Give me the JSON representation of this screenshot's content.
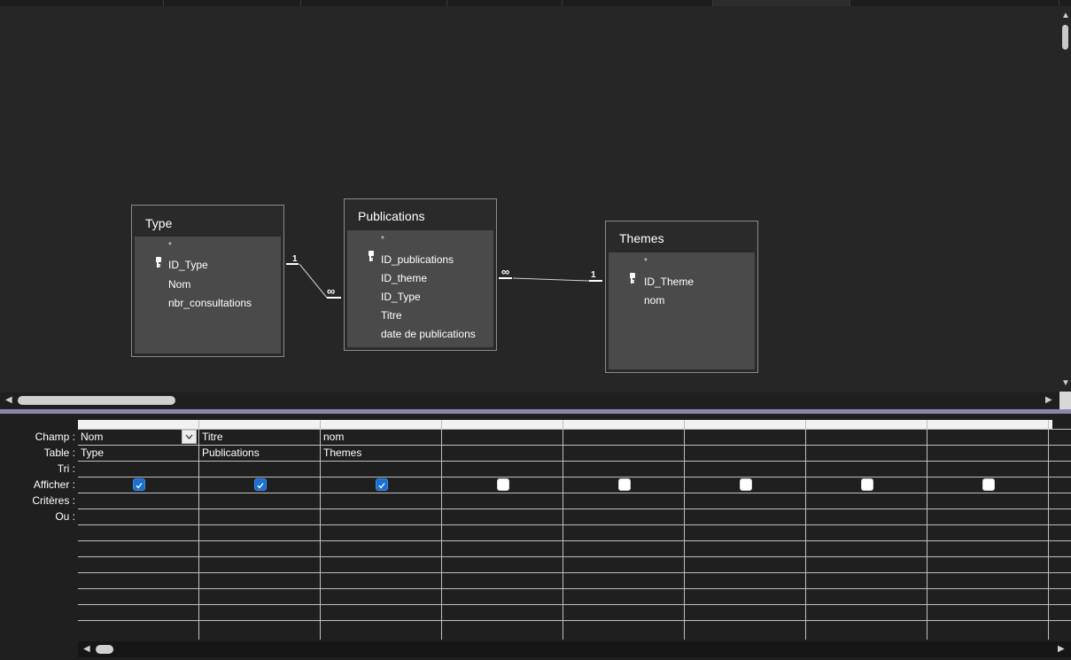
{
  "tables": {
    "type": {
      "title": "Type",
      "star": "*",
      "fields": [
        "ID_Type",
        "Nom",
        "nbr_consultations"
      ]
    },
    "publications": {
      "title": "Publications",
      "star": "*",
      "fields": [
        "ID_publications",
        "ID_theme",
        "ID_Type",
        "Titre",
        "date de publications"
      ]
    },
    "themes": {
      "title": "Themes",
      "star": "*",
      "fields": [
        "ID_Theme",
        "nom"
      ]
    }
  },
  "relationships": {
    "type_publications": {
      "one": "1",
      "many": "∞"
    },
    "publications_themes": {
      "many": "∞",
      "one": "1"
    }
  },
  "grid": {
    "row_labels": [
      "Champ :",
      "Table :",
      "Tri :",
      "Afficher :",
      "Critères :",
      "Ou :"
    ],
    "columns": [
      {
        "field": "Nom",
        "table": "Type",
        "show": true
      },
      {
        "field": "Titre",
        "table": "Publications",
        "show": true
      },
      {
        "field": "nom",
        "table": "Themes",
        "show": true
      },
      {
        "field": "",
        "table": "",
        "show": false
      },
      {
        "field": "",
        "table": "",
        "show": false
      },
      {
        "field": "",
        "table": "",
        "show": false
      },
      {
        "field": "",
        "table": "",
        "show": false
      },
      {
        "field": "",
        "table": "",
        "show": false
      }
    ]
  },
  "icons": {
    "primary_key": "key-icon",
    "dropdown": "chevron-down-icon",
    "scroll_left": "triangle-left-icon",
    "scroll_right": "triangle-right-icon",
    "scroll_up": "triangle-up-icon",
    "scroll_down": "triangle-down-icon"
  },
  "colors": {
    "background": "#262626",
    "table_body": "#4a4a4a",
    "checkbox_checked": "#1a6fd0",
    "splitter": "#8b86ad"
  }
}
